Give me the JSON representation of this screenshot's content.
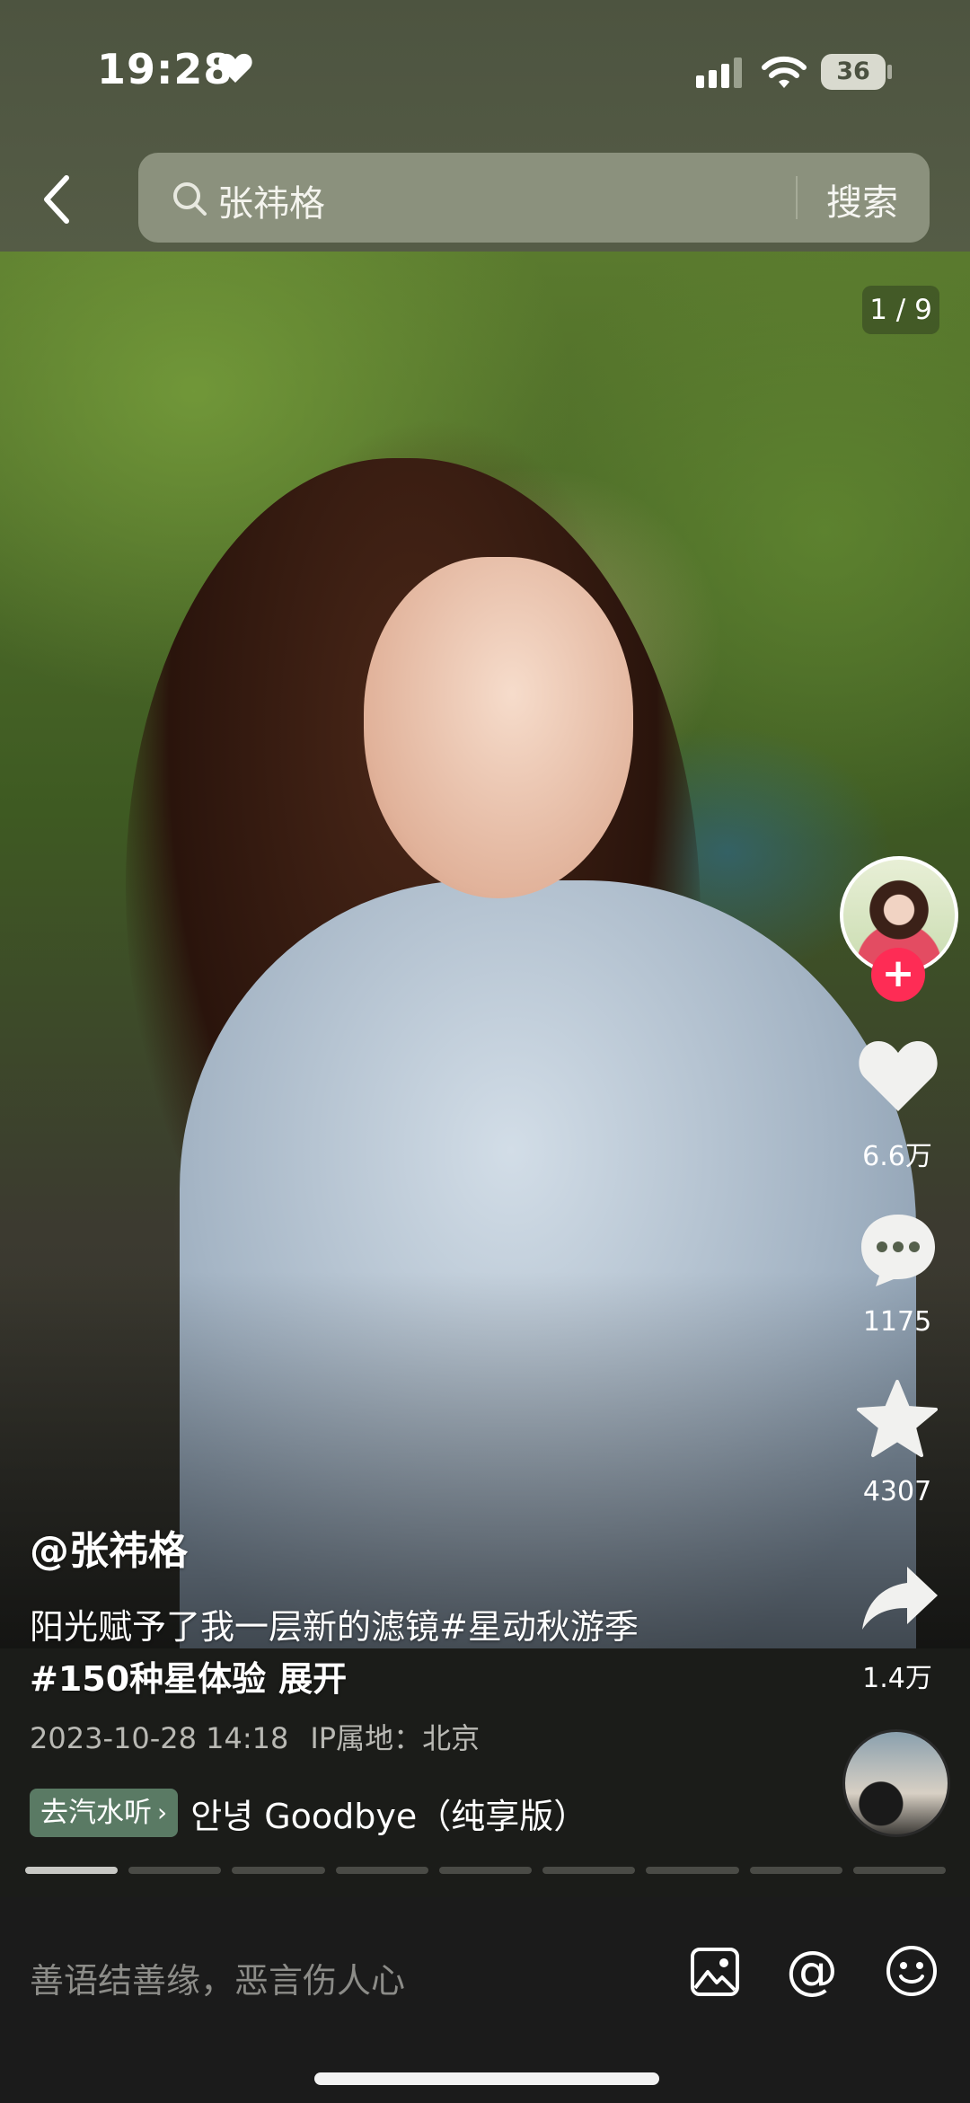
{
  "status_bar": {
    "time": "19:28",
    "battery": "36"
  },
  "search": {
    "query": "张祎格",
    "button_label": "搜索"
  },
  "post": {
    "page_counter": "1 / 9",
    "author": "@张祎格",
    "caption_line1": "阳光赋予了我一层新的滤镜#星动秋游季",
    "caption_line2": "#150种星体验",
    "expand_label": "展开",
    "datetime": "2023-10-28 14:18",
    "ip_location": "IP属地：北京",
    "photo_index": 1,
    "photo_total": 9
  },
  "music": {
    "chip_label": "去汽水听",
    "title": "안녕 Goodbye（纯享版）"
  },
  "actions": {
    "likes": "6.6万",
    "comments": "1175",
    "favorites": "4307",
    "shares": "1.4万"
  },
  "comment_bar": {
    "placeholder": "善语结善缘，恶言伤人心"
  },
  "colors": {
    "follow_red": "#fe2c55",
    "music_chip": "#5a7a64",
    "topbar": "#4d5440"
  },
  "icons": [
    "heart-icon",
    "signal-icon",
    "wifi-icon",
    "battery-icon",
    "back-arrow-icon",
    "search-icon",
    "heart-like-icon",
    "comment-icon",
    "star-icon",
    "share-icon",
    "image-icon",
    "at-icon",
    "emoji-icon"
  ]
}
